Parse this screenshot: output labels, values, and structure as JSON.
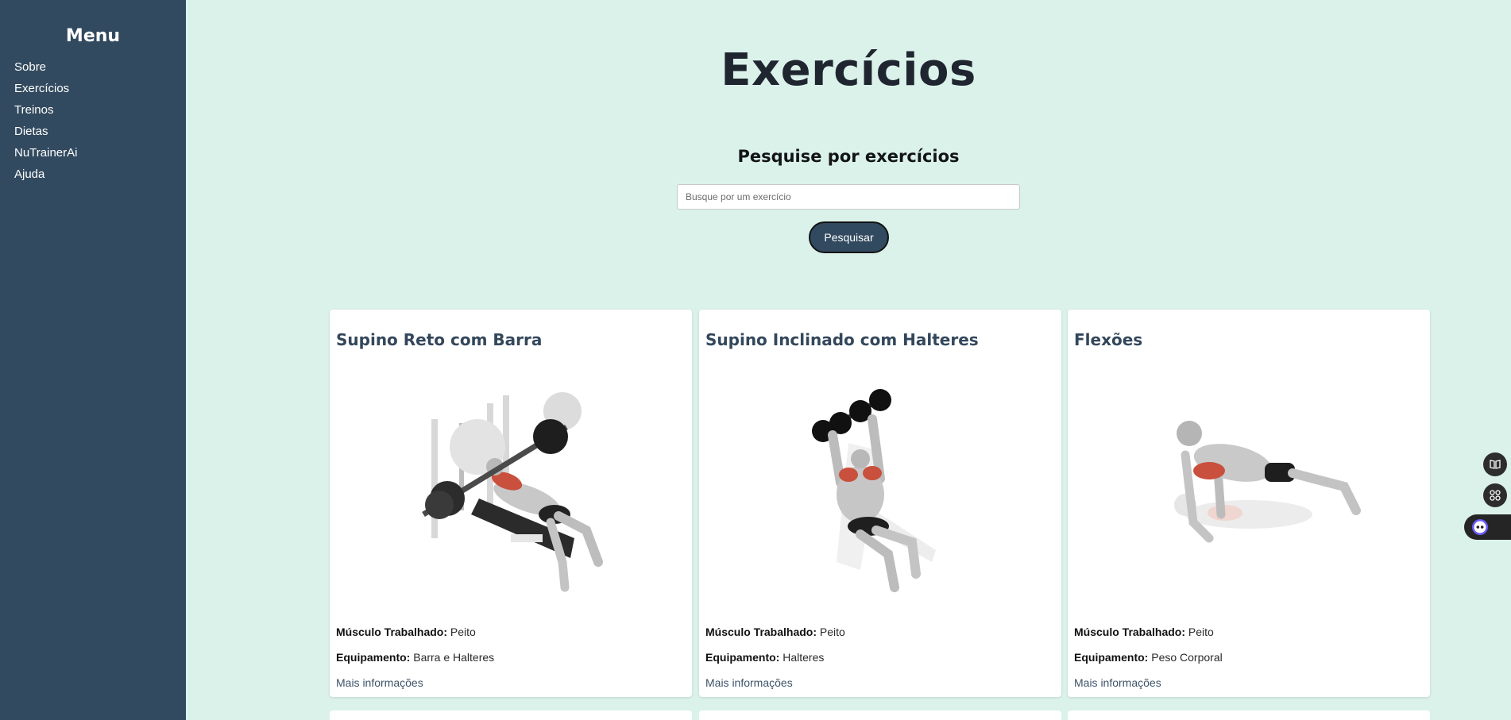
{
  "sidebar": {
    "title": "Menu",
    "items": [
      {
        "label": "Sobre"
      },
      {
        "label": "Exercícios"
      },
      {
        "label": "Treinos"
      },
      {
        "label": "Dietas"
      },
      {
        "label": "NuTrainerAi"
      },
      {
        "label": "Ajuda"
      }
    ]
  },
  "main": {
    "title": "Exercícios",
    "search": {
      "heading": "Pesquise por exercícios",
      "placeholder": "Busque por um exercício",
      "button": "Pesquisar"
    },
    "cards": [
      {
        "title": "Supino Reto com Barra",
        "muscle_label": "Músculo Trabalhado:",
        "muscle": "Peito",
        "equipment_label": "Equipamento:",
        "equipment": "Barra e Halteres",
        "more": "Mais informações"
      },
      {
        "title": "Supino Inclinado com Halteres",
        "muscle_label": "Músculo Trabalhado:",
        "muscle": "Peito",
        "equipment_label": "Equipamento:",
        "equipment": "Halteres",
        "more": "Mais informações"
      },
      {
        "title": "Flexões",
        "muscle_label": "Músculo Trabalhado:",
        "muscle": "Peito",
        "equipment_label": "Equipamento:",
        "equipment": "Peso Corporal",
        "more": "Mais informações"
      }
    ]
  },
  "floating": {
    "icons": [
      "book-icon",
      "apps-icon",
      "chat-bot-icon"
    ]
  },
  "colors": {
    "sidebar_bg": "#324a5f",
    "page_bg": "#dbf2ea",
    "card_bg": "#ffffff",
    "button_bg": "#324a5f",
    "muscle_highlight": "#c9503c"
  }
}
